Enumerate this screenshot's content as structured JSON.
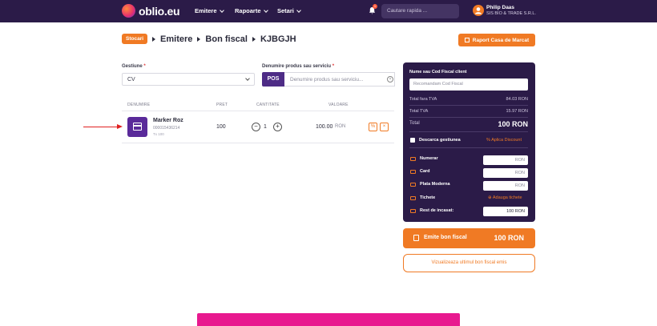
{
  "nav": {
    "logo_text": "oblio.eu",
    "menu": [
      "Emitere",
      "Rapoarte",
      "Setari"
    ],
    "notification_count": "1",
    "search_placeholder": "Cautare rapida ...",
    "user_name": "Philip Daas",
    "user_company": "SIS BIO & TRADE S.R.L."
  },
  "breadcrumb": {
    "tag": "Stocari",
    "items": [
      "Emitere",
      "Bon fiscal",
      "KJBGJH"
    ]
  },
  "report_button": "Raport Casa de Marcat",
  "form": {
    "gestiune_label": "Gestiune",
    "gestiune_value": "CV",
    "produs_label": "Denumire produs sau serviciu",
    "pos_label": "POS",
    "produs_placeholder": "Denumire produs sau serviciu..."
  },
  "table": {
    "headers": [
      "DENUMIRE",
      "PRET",
      "CANTITATE",
      "VALOARE"
    ],
    "row": {
      "name": "Marker Roz",
      "code": "000015436214",
      "tax": "Tx 100",
      "price": "100",
      "qty": "1",
      "value": "100.00",
      "currency": "RON"
    }
  },
  "panel": {
    "client_label": "Nume sau Cod Fiscal client",
    "client_placeholder": "Recomandam Cod Fiscal",
    "total_fara_tva_label": "Total fara TVA",
    "total_fara_tva": "84.03 RON",
    "total_tva_label": "Total TVA",
    "total_tva": "15.97 RON",
    "total_label": "Total",
    "total": "100 RON",
    "descarca_label": "Descarca gestiunea",
    "discount_label": "% Aplica Discount",
    "payments": [
      {
        "label": "Numerar",
        "value": "RON"
      },
      {
        "label": "Card",
        "value": "RON"
      },
      {
        "label": "Plata Moderna",
        "value": "RON"
      },
      {
        "label": "Tichete",
        "value": ""
      },
      {
        "label": "Rest de incasat:",
        "value": "100 RON"
      }
    ],
    "add_ticket_label": "Adauga tichete"
  },
  "emit_button": {
    "label": "Emite bon fiscal",
    "amount": "100 RON"
  },
  "last_button": "Vizualizeaza ultimul bon fiscal emis"
}
